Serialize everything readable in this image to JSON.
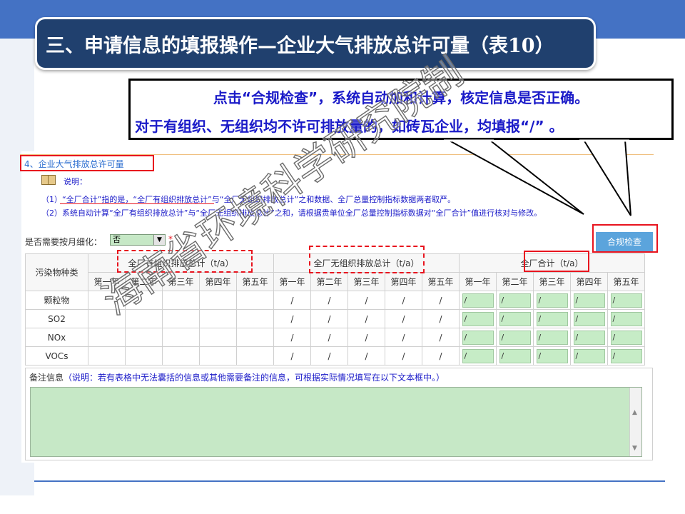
{
  "slide": {
    "title": "三、申请信息的填报操作—企业大气排放总许可量（表10）",
    "callout_line1": "点击“合规检查”，系统自动加和计算，核定信息是否正确。",
    "callout_line2": "对于有组织、无组织均不许可排放量的，如砖瓦企业，均填报“/” 。",
    "watermark": "海南省环境科学研究院制"
  },
  "form": {
    "section_title": "4、企业大气排放总许可量",
    "notes_label": "说明：",
    "note1": "（1）“全厂合计”指的是，“全厂有组织排放总计”与“全厂无组织排放总计”之和数据、全厂总量控制指标数据两者取严。",
    "note2": "（2）系统自动计算“全厂有组织排放总计”与“全厂无组织排放总计”之和，请根据贵单位全厂总量控制指标数据对“全厂合计”值进行核对与修改。",
    "monthly_label": "是否需要按月细化：",
    "monthly_value": "否",
    "required_mark": "*",
    "check_button": "合规检查"
  },
  "table": {
    "pollutant_header": "污染物种类",
    "group_headers": [
      "全厂有组织排放总计（t/a）",
      "全厂无组织排放总计（t/a）",
      "全厂合计（t/a）"
    ],
    "years": [
      "第一年",
      "第二年",
      "第三年",
      "第四年",
      "第五年"
    ],
    "rows": [
      {
        "name": "颗粒物",
        "organized": [
          "",
          "",
          "",
          "",
          ""
        ],
        "unorganized": [
          "/",
          "/",
          "/",
          "/",
          "/"
        ],
        "total": [
          "/",
          "/",
          "/",
          "/",
          "/"
        ]
      },
      {
        "name": "SO2",
        "organized": [
          "",
          "",
          "",
          "",
          ""
        ],
        "unorganized": [
          "/",
          "/",
          "/",
          "/",
          "/"
        ],
        "total": [
          "/",
          "/",
          "/",
          "/",
          "/"
        ]
      },
      {
        "name": "NOx",
        "organized": [
          "",
          "",
          "",
          "",
          ""
        ],
        "unorganized": [
          "/",
          "/",
          "/",
          "/",
          "/"
        ],
        "total": [
          "/",
          "/",
          "/",
          "/",
          "/"
        ]
      },
      {
        "name": "VOCs",
        "organized": [
          "",
          "",
          "",
          "",
          ""
        ],
        "unorganized": [
          "/",
          "/",
          "/",
          "/",
          "/"
        ],
        "total": [
          "/",
          "/",
          "/",
          "/",
          "/"
        ]
      }
    ]
  },
  "remark": {
    "label": "备注信息",
    "hint": "（说明：若有表格中无法囊括的信息或其他需要备注的信息，可根据实际情况填写在以下文本框中。）",
    "value": ""
  }
}
